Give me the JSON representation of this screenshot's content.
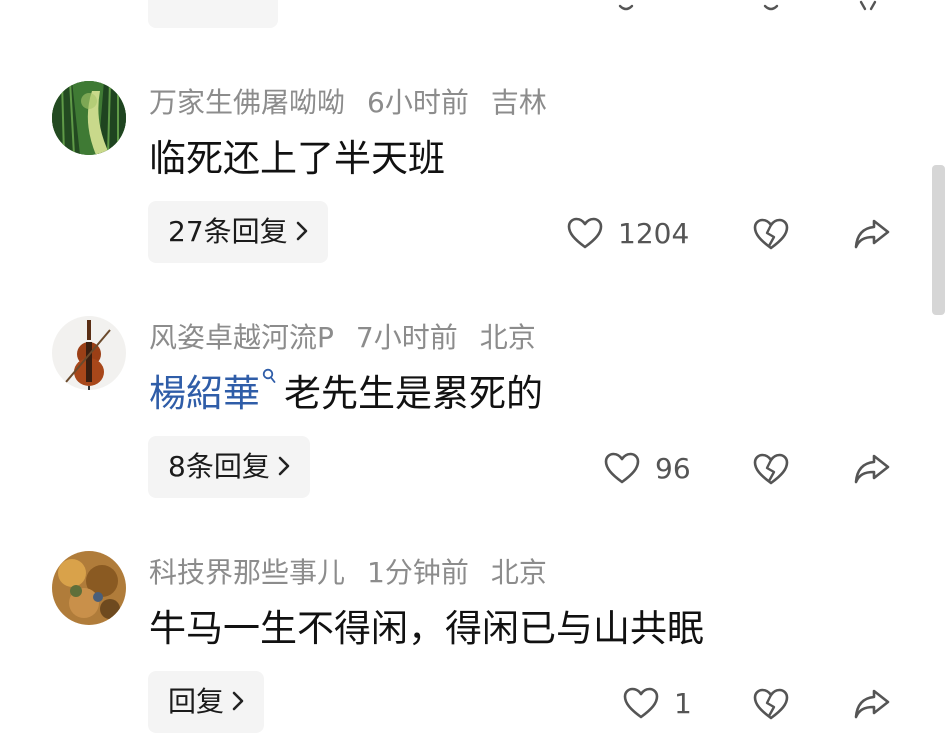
{
  "comments": [
    {
      "author": "万家生佛屠呦呦",
      "time": "6小时前",
      "location": "吉林",
      "mention": "",
      "text": "临死还上了半天班",
      "reply_label": "27条回复",
      "likes": "1204",
      "avatar_icon": "bamboo-path-avatar"
    },
    {
      "author": "风姿卓越河流P",
      "time": "7小时前",
      "location": "北京",
      "mention": "楊紹華",
      "text": "老先生是累死的",
      "reply_label": "8条回复",
      "likes": "96",
      "avatar_icon": "cello-avatar"
    },
    {
      "author": "科技界那些事儿",
      "time": "1分钟前",
      "location": "北京",
      "mention": "",
      "text": "牛马一生不得闲，得闲已与山共眠",
      "reply_label": "回复",
      "likes": "1",
      "avatar_icon": "textured-food-avatar"
    }
  ],
  "icons": {
    "like": "heart-outline-icon",
    "dislike": "broken-heart-icon",
    "share": "share-arrow-icon",
    "expand": "chevron-right-icon",
    "mention": "search-icon"
  },
  "colors": {
    "meta": "#8c8c8c",
    "mention": "#2f5da8",
    "chip_bg": "#f4f4f4"
  }
}
